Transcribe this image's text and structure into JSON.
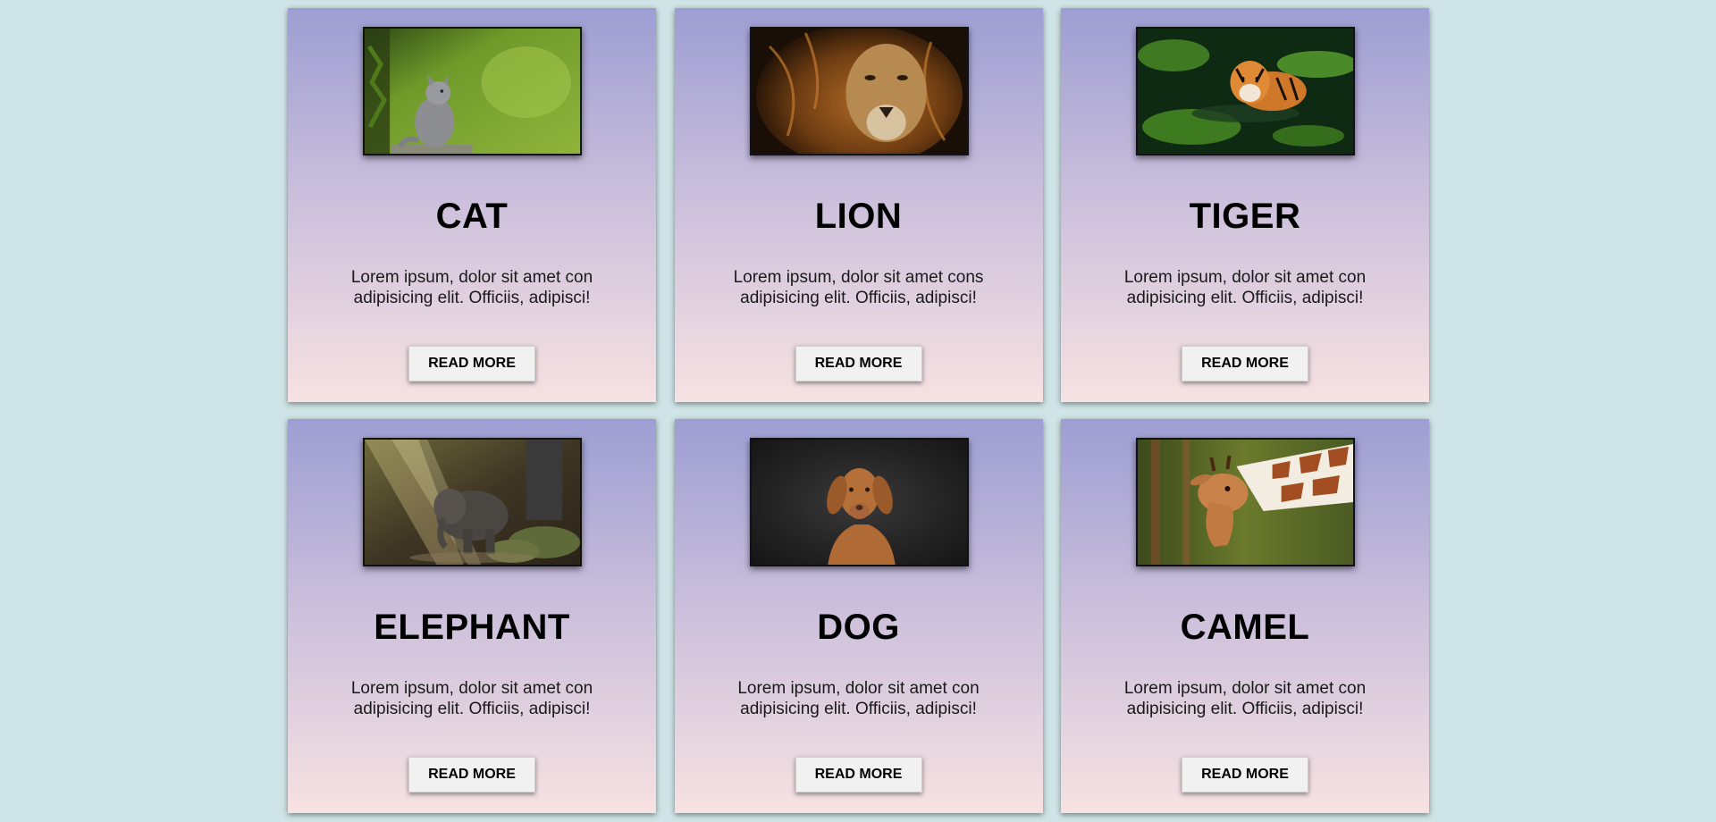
{
  "cards": [
    {
      "title": "CAT",
      "desc_line1": "Lorem ipsum, dolor sit amet con",
      "desc_line2": "adipisicing elit. Officiis, adipisci!",
      "button": "READ MORE",
      "image_icon": "cat-photo-icon"
    },
    {
      "title": "LION",
      "desc_line1": "Lorem ipsum, dolor sit amet cons",
      "desc_line2": "adipisicing elit. Officiis, adipisci!",
      "button": "READ MORE",
      "image_icon": "lion-photo-icon"
    },
    {
      "title": "TIGER",
      "desc_line1": "Lorem ipsum, dolor sit amet con",
      "desc_line2": "adipisicing elit. Officiis, adipisci!",
      "button": "READ MORE",
      "image_icon": "tiger-photo-icon"
    },
    {
      "title": "ELEPHANT",
      "desc_line1": "Lorem ipsum, dolor sit amet con",
      "desc_line2": "adipisicing elit. Officiis, adipisci!",
      "button": "READ MORE",
      "image_icon": "elephant-photo-icon"
    },
    {
      "title": "DOG",
      "desc_line1": "Lorem ipsum, dolor sit amet con",
      "desc_line2": "adipisicing elit. Officiis, adipisci!",
      "button": "READ MORE",
      "image_icon": "dog-photo-icon"
    },
    {
      "title": "CAMEL",
      "desc_line1": "Lorem ipsum, dolor sit amet con",
      "desc_line2": "adipisicing elit. Officiis, adipisci!",
      "button": "READ MORE",
      "image_icon": "giraffe-photo-icon"
    }
  ],
  "colors": {
    "page_background": "#cfe4e6",
    "card_gradient_top": "#9d9ed3",
    "card_gradient_bottom": "#f7e2e2",
    "button_background": "#f1f1f1"
  }
}
